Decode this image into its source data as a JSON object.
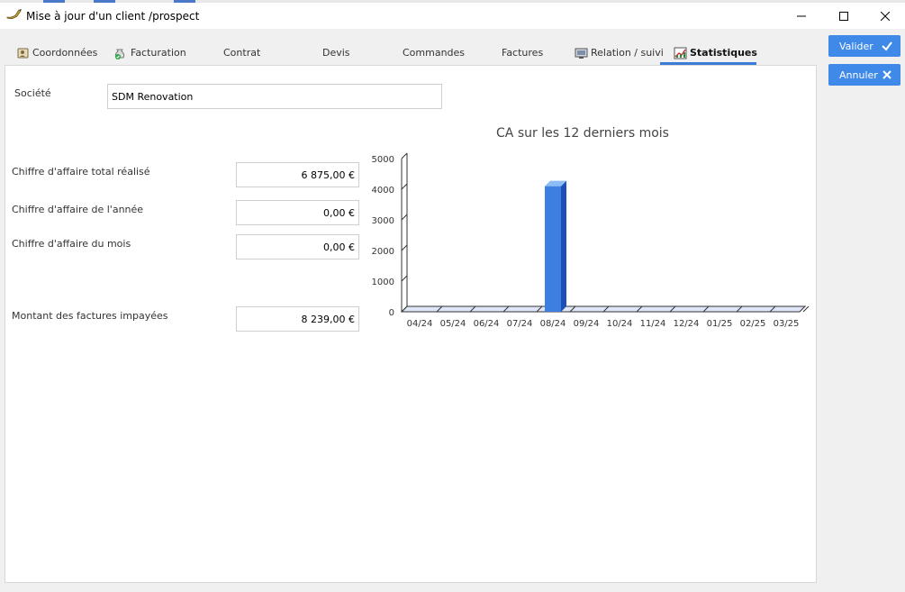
{
  "window": {
    "title": "Mise à jour  d'un client /prospect",
    "icon": "pen-icon"
  },
  "tabs": [
    {
      "label": "Coordonnées",
      "icon": "address-book-icon"
    },
    {
      "label": "Facturation",
      "icon": "money-bag-icon"
    },
    {
      "label": "Contrat",
      "icon": ""
    },
    {
      "label": "Devis",
      "icon": ""
    },
    {
      "label": "Commandes",
      "icon": ""
    },
    {
      "label": "Factures",
      "icon": ""
    },
    {
      "label": "Relation / suivi",
      "icon": "relation-icon"
    },
    {
      "label": "Statistiques",
      "icon": "chart-icon"
    }
  ],
  "active_tab": "Statistiques",
  "actions": {
    "valider_label": "Valider",
    "annuler_label": "Annuler"
  },
  "form": {
    "societe_label": "Société",
    "societe_value": "SDM Renovation",
    "ca_total_label": "Chiffre d'affaire total réalisé",
    "ca_total_value": "6 875,00 €",
    "ca_annee_label": "Chiffre d'affaire de l'année",
    "ca_annee_value": "0,00 €",
    "ca_mois_label": "Chiffre d'affaire du mois",
    "ca_mois_value": "0,00 €",
    "impayees_label": "Montant des factures impayées",
    "impayees_value": "8 239,00 €"
  },
  "colors": {
    "accent": "#3f8ae8",
    "bar": "#3d7fe0",
    "bar_side": "#1c4fb8",
    "bar_top": "#8cbcf5"
  },
  "chart_data": {
    "type": "bar",
    "title": "CA sur les 12 derniers mois",
    "categories": [
      "04/24",
      "05/24",
      "06/24",
      "07/24",
      "08/24",
      "09/24",
      "10/24",
      "11/24",
      "12/24",
      "01/25",
      "02/25",
      "03/25"
    ],
    "values": [
      0,
      0,
      0,
      0,
      4100,
      0,
      0,
      0,
      0,
      0,
      0,
      0
    ],
    "yticks": [
      0,
      1000,
      2000,
      3000,
      4000,
      5000
    ],
    "ylim": [
      0,
      5000
    ],
    "xlabel": "",
    "ylabel": "",
    "grid": false,
    "style": "3d"
  }
}
